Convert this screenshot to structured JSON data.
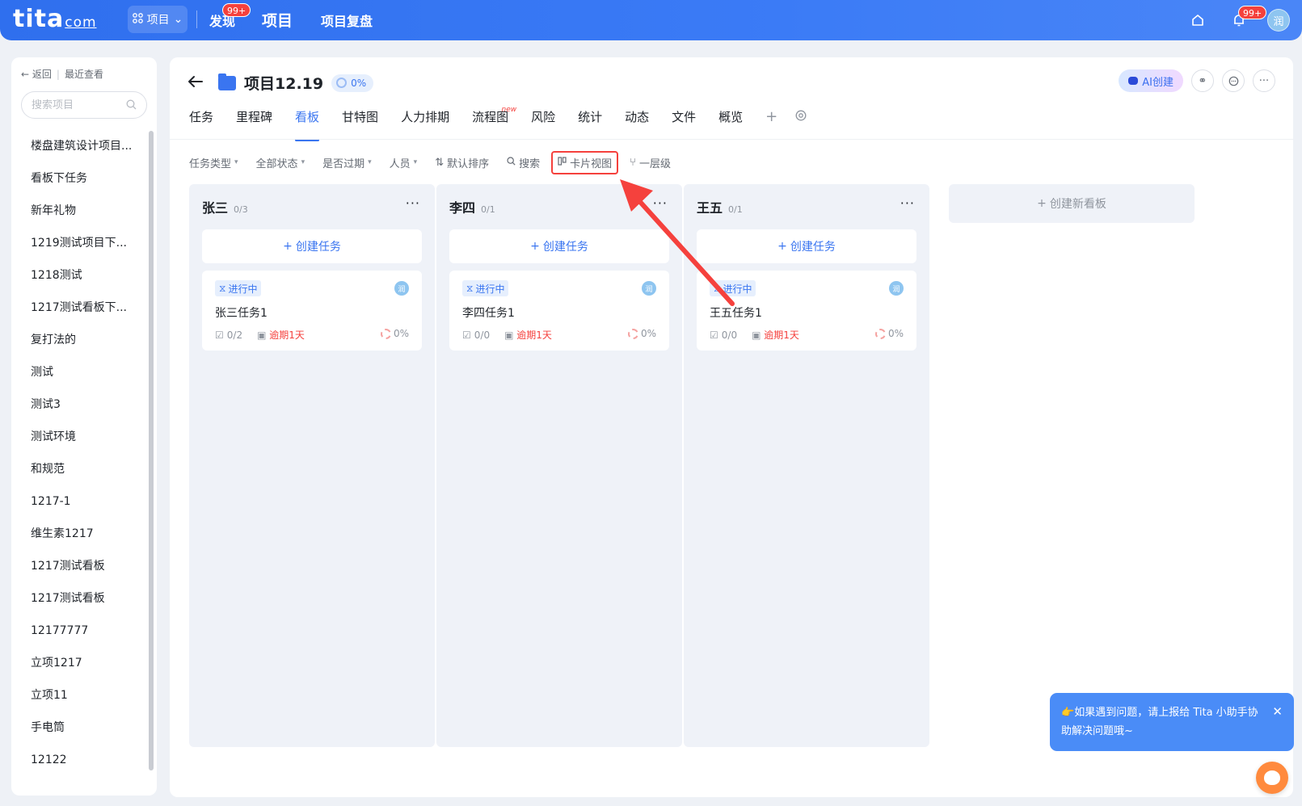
{
  "topbar": {
    "logo_main": "tita",
    "logo_suffix": "com",
    "app_switch_label": "项目",
    "nav": [
      {
        "label": "发现",
        "badge": "99+"
      },
      {
        "label": "项目"
      },
      {
        "label": "项目复盘"
      }
    ],
    "notification_badge": "99+",
    "avatar_text": "润"
  },
  "sidebar": {
    "back_label": "返回",
    "recent_label": "最近查看",
    "search_placeholder": "搜索项目",
    "items": [
      "楼盘建筑设计项目...",
      "看板下任务",
      "新年礼物",
      "1219测试项目下...",
      "1218测试",
      "1217测试看板下...",
      "复打法的",
      "测试",
      "测试3",
      "测试环境",
      "和规范",
      "1217-1",
      "维生素1217",
      "1217测试看板",
      "1217测试看板",
      "12177777",
      "立项1217",
      "立项11",
      "手电筒",
      "12122"
    ]
  },
  "project": {
    "title": "项目12.19",
    "progress": "0%",
    "ai_label": "AI创建"
  },
  "tabs": [
    {
      "label": "任务"
    },
    {
      "label": "里程碑"
    },
    {
      "label": "看板",
      "active": true
    },
    {
      "label": "甘特图"
    },
    {
      "label": "人力排期"
    },
    {
      "label": "流程图",
      "tag": "new"
    },
    {
      "label": "风险"
    },
    {
      "label": "统计"
    },
    {
      "label": "动态"
    },
    {
      "label": "文件"
    },
    {
      "label": "概览"
    }
  ],
  "toolbar": {
    "task_type": "任务类型",
    "status": "全部状态",
    "overdue": "是否过期",
    "people": "人员",
    "sort": "默认排序",
    "search": "搜索",
    "card_view": "卡片视图",
    "level": "一层级"
  },
  "board": {
    "create_task_label": "创建任务",
    "create_board_label": "创建新看板",
    "columns": [
      {
        "name": "张三",
        "count": "0/3",
        "card": {
          "status": "进行中",
          "avatar": "润",
          "title": "张三任务1",
          "checklist": "0/2",
          "due": "逾期1天",
          "progress": "0%"
        }
      },
      {
        "name": "李四",
        "count": "0/1",
        "card": {
          "status": "进行中",
          "avatar": "润",
          "title": "李四任务1",
          "checklist": "0/0",
          "due": "逾期1天",
          "progress": "0%"
        }
      },
      {
        "name": "王五",
        "count": "0/1",
        "card": {
          "status": "进行中",
          "avatar": "润",
          "title": "王五任务1",
          "checklist": "0/0",
          "due": "逾期1天",
          "progress": "0%"
        }
      }
    ]
  },
  "toast": {
    "emoji": "👉",
    "message": "如果遇到问题，请上报给 Tita 小助手协助解决问题哦~"
  },
  "colors": {
    "brand": "#3a75f0",
    "overdue": "#f5413d",
    "annotation": "#f5413d"
  }
}
